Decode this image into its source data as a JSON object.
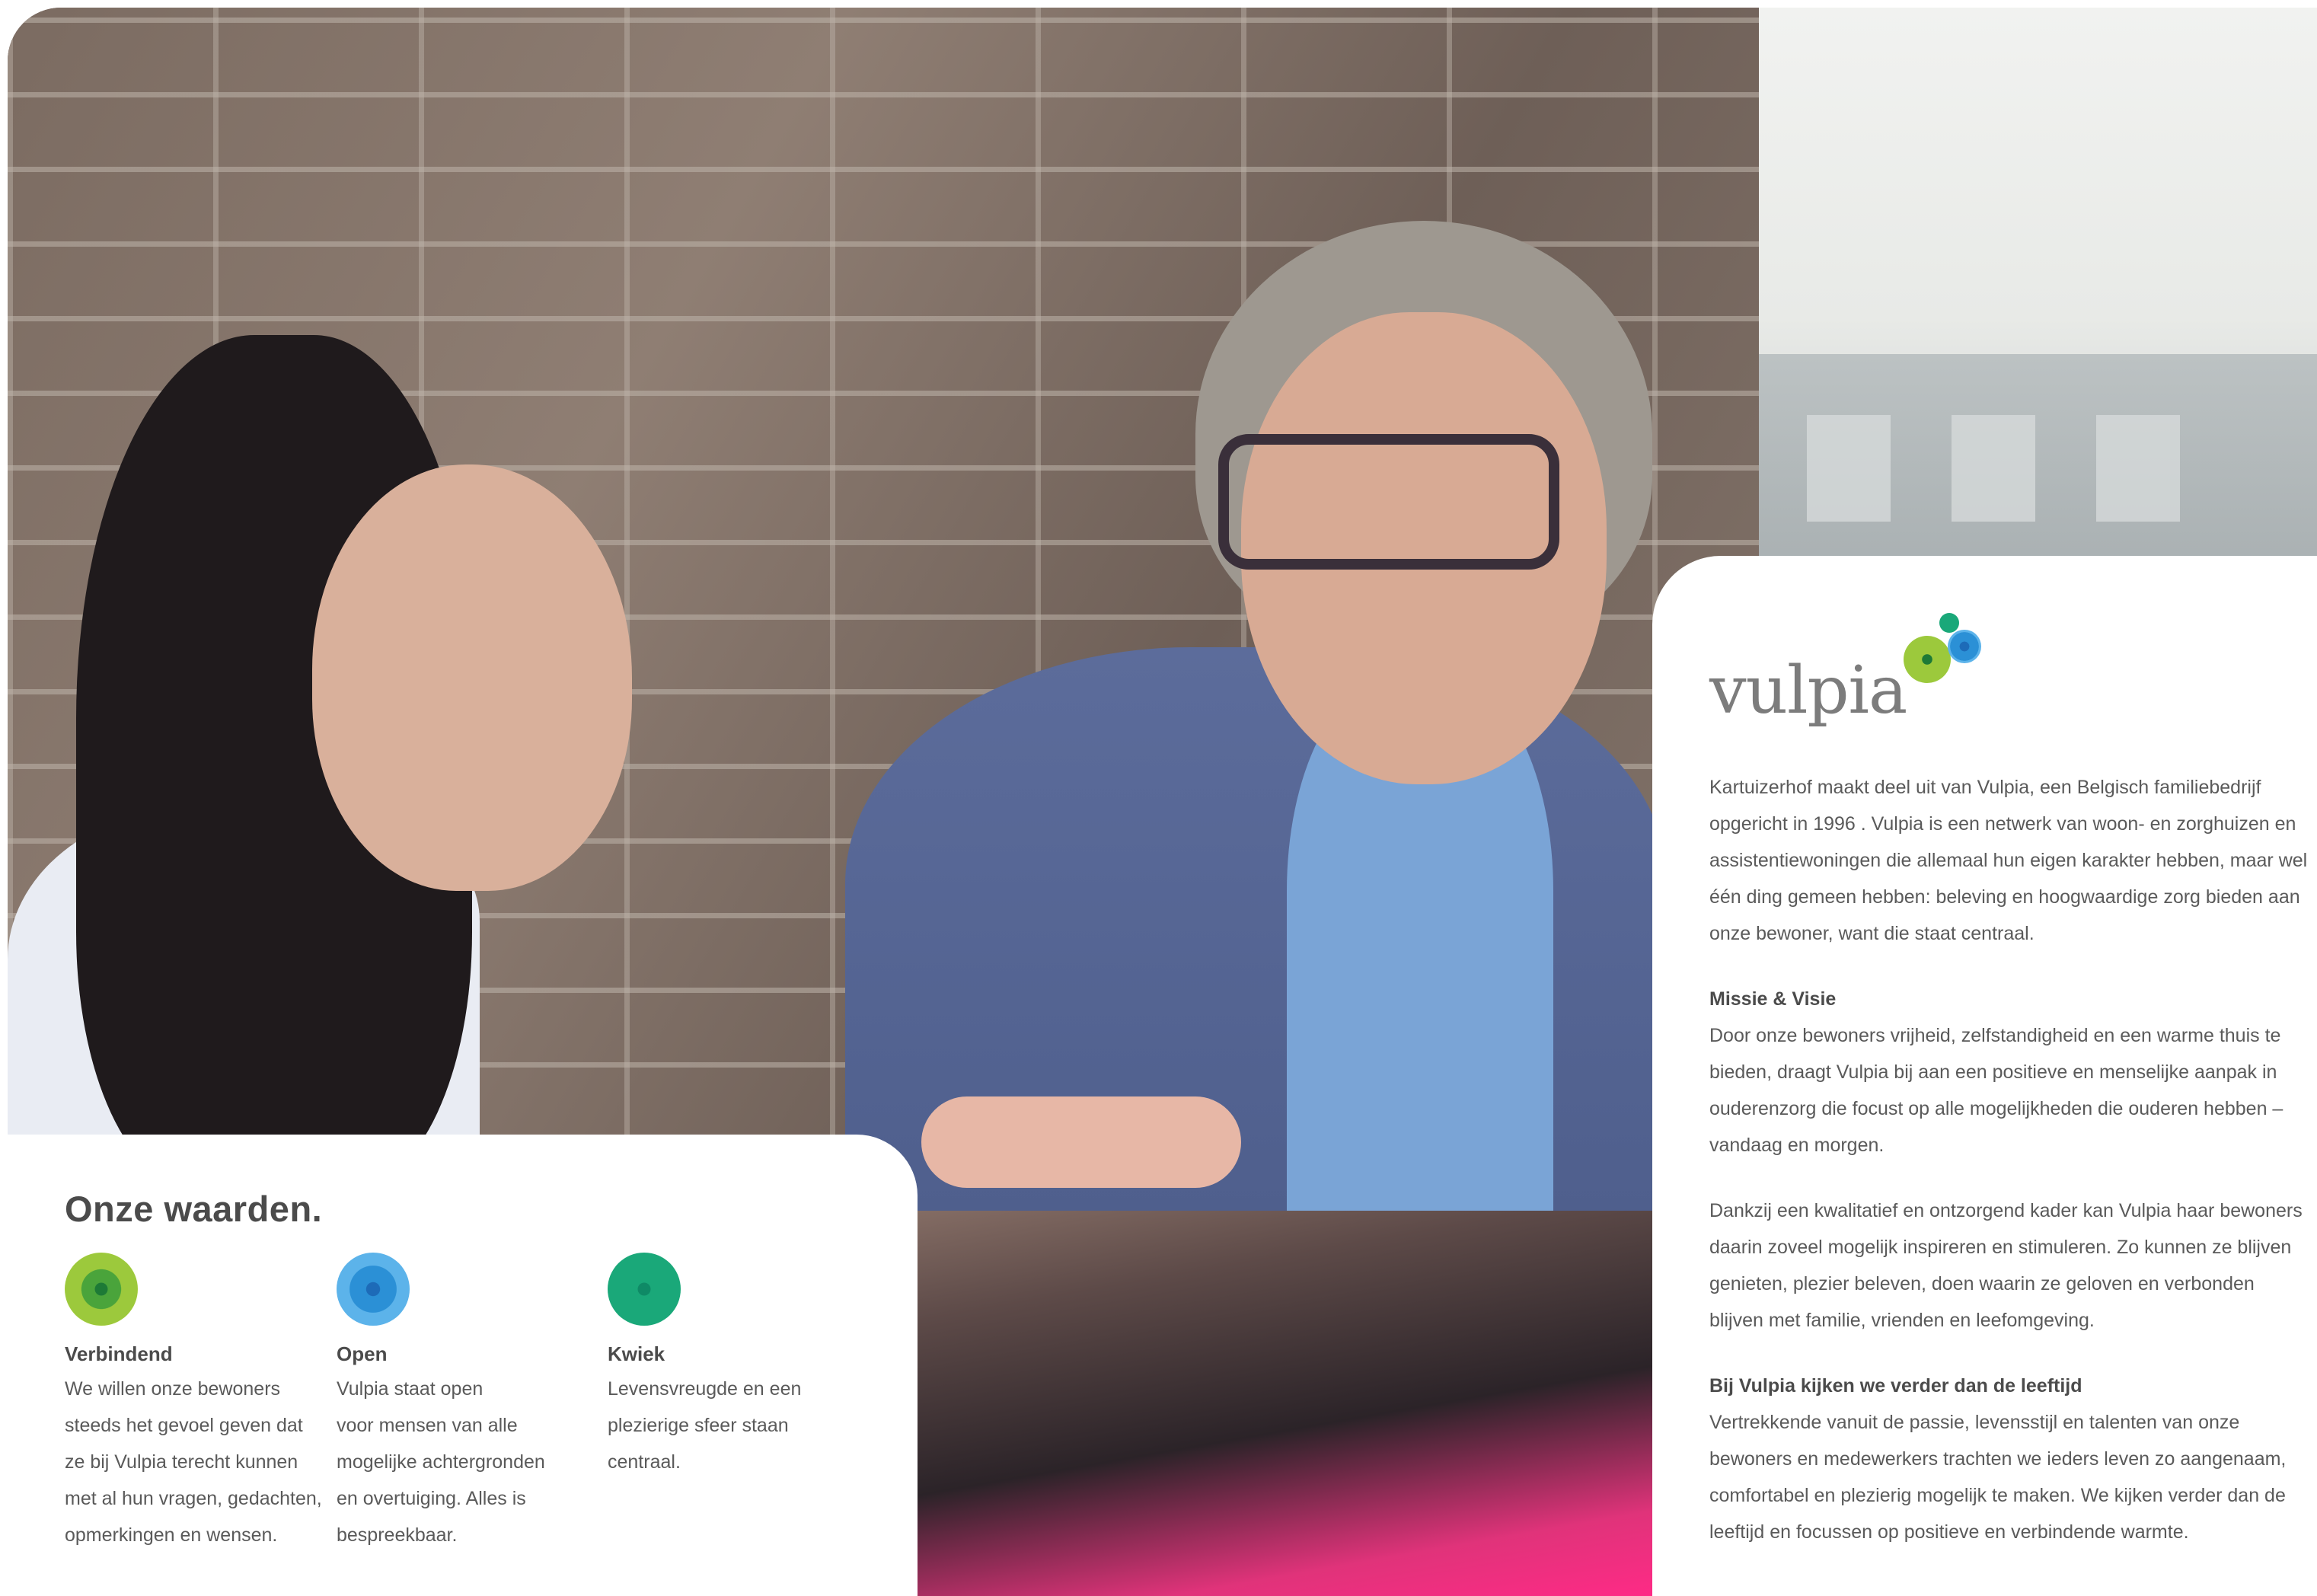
{
  "values": {
    "title": "Onze waarden.",
    "items": [
      {
        "icon": "green-ring-dot-icon",
        "color": "#9cc93c",
        "title": "Verbindend",
        "text": "We willen onze bewoners\nsteeds het gevoel geven dat\nze bij Vulpia terecht kunnen\nmet al hun vragen, gedachten,\nopmerkingen en wensen."
      },
      {
        "icon": "blue-ring-dot-icon",
        "color": "#2b90d6",
        "title": "Open",
        "text": "Vulpia staat open\nvoor mensen van alle\nmogelijke achtergronden\nen overtuiging. Alles is\nbespreekbaar."
      },
      {
        "icon": "teal-dot-icon",
        "color": "#1aa879",
        "title": "Kwiek",
        "text": "Levensvreugde en een\nplezierige sfeer staan\ncentraal."
      }
    ]
  },
  "brand": {
    "name": "vulpia",
    "dot_colors": [
      "#1aa879",
      "#9cc93c",
      "#2b90d6"
    ]
  },
  "about": {
    "intro": "Kartuizerhof maakt deel uit van Vulpia, een Belgisch familiebedrijf opgericht in 1996 . Vulpia is een netwerk van woon- en zorghuizen en assistentiewoningen die allemaal hun eigen karakter hebben, maar wel één ding gemeen hebben: beleving en hoogwaardige zorg bieden aan onze bewoner, want die staat centraal.",
    "mission_heading": "Missie & Visie",
    "mission_text": "Door onze bewoners vrijheid, zelfstandigheid en een warme thuis te bieden, draagt Vulpia bij aan een positieve en menselijke aanpak in ouderenzorg die focust op alle mogelijkheden die ouderen hebben – vandaag en morgen.",
    "framework_text": "Dankzij een kwalitatief en ontzorgend kader kan Vulpia haar bewoners daarin zoveel mogelijk inspireren en stimuleren. Zo kunnen ze blijven genieten, plezier beleven, doen waarin ze geloven en verbonden blijven met familie, vrienden en leefomgeving.",
    "age_heading": "Bij Vulpia kijken we verder dan de leeftijd",
    "age_text": "Vertrekkende vanuit de passie, levensstijl en talenten van onze bewoners en medewerkers trachten we ieders leven zo aangenaam, comfortabel en plezierig mogelijk te maken. We kijken verder dan de leeftijd en focussen op positieve en verbindende warmte."
  }
}
